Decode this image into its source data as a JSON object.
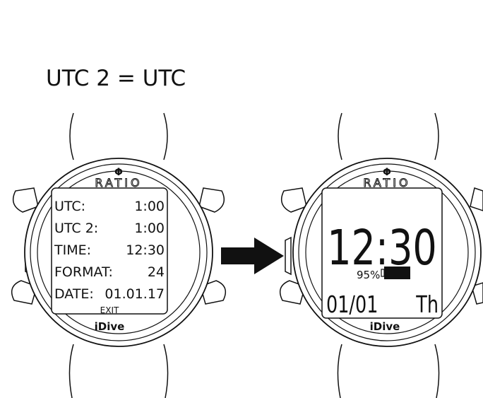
{
  "caption": "UTC 2 = UTC",
  "brand": {
    "symbol": "Φ",
    "name": "RATIO",
    "model": "iDive"
  },
  "left_watch": {
    "rows": [
      {
        "label": "UTC:",
        "value": "1:00"
      },
      {
        "label": "UTC 2:",
        "value": "1:00"
      },
      {
        "label": "TIME:",
        "value": "12:30"
      },
      {
        "label": "FORMAT:",
        "value": "24"
      },
      {
        "label": "DATE:",
        "value": "01.01.17"
      }
    ],
    "exit_label": "EXIT"
  },
  "right_watch": {
    "time": "12:30",
    "battery": "95%",
    "date": "01/01",
    "weekday": "Th"
  }
}
